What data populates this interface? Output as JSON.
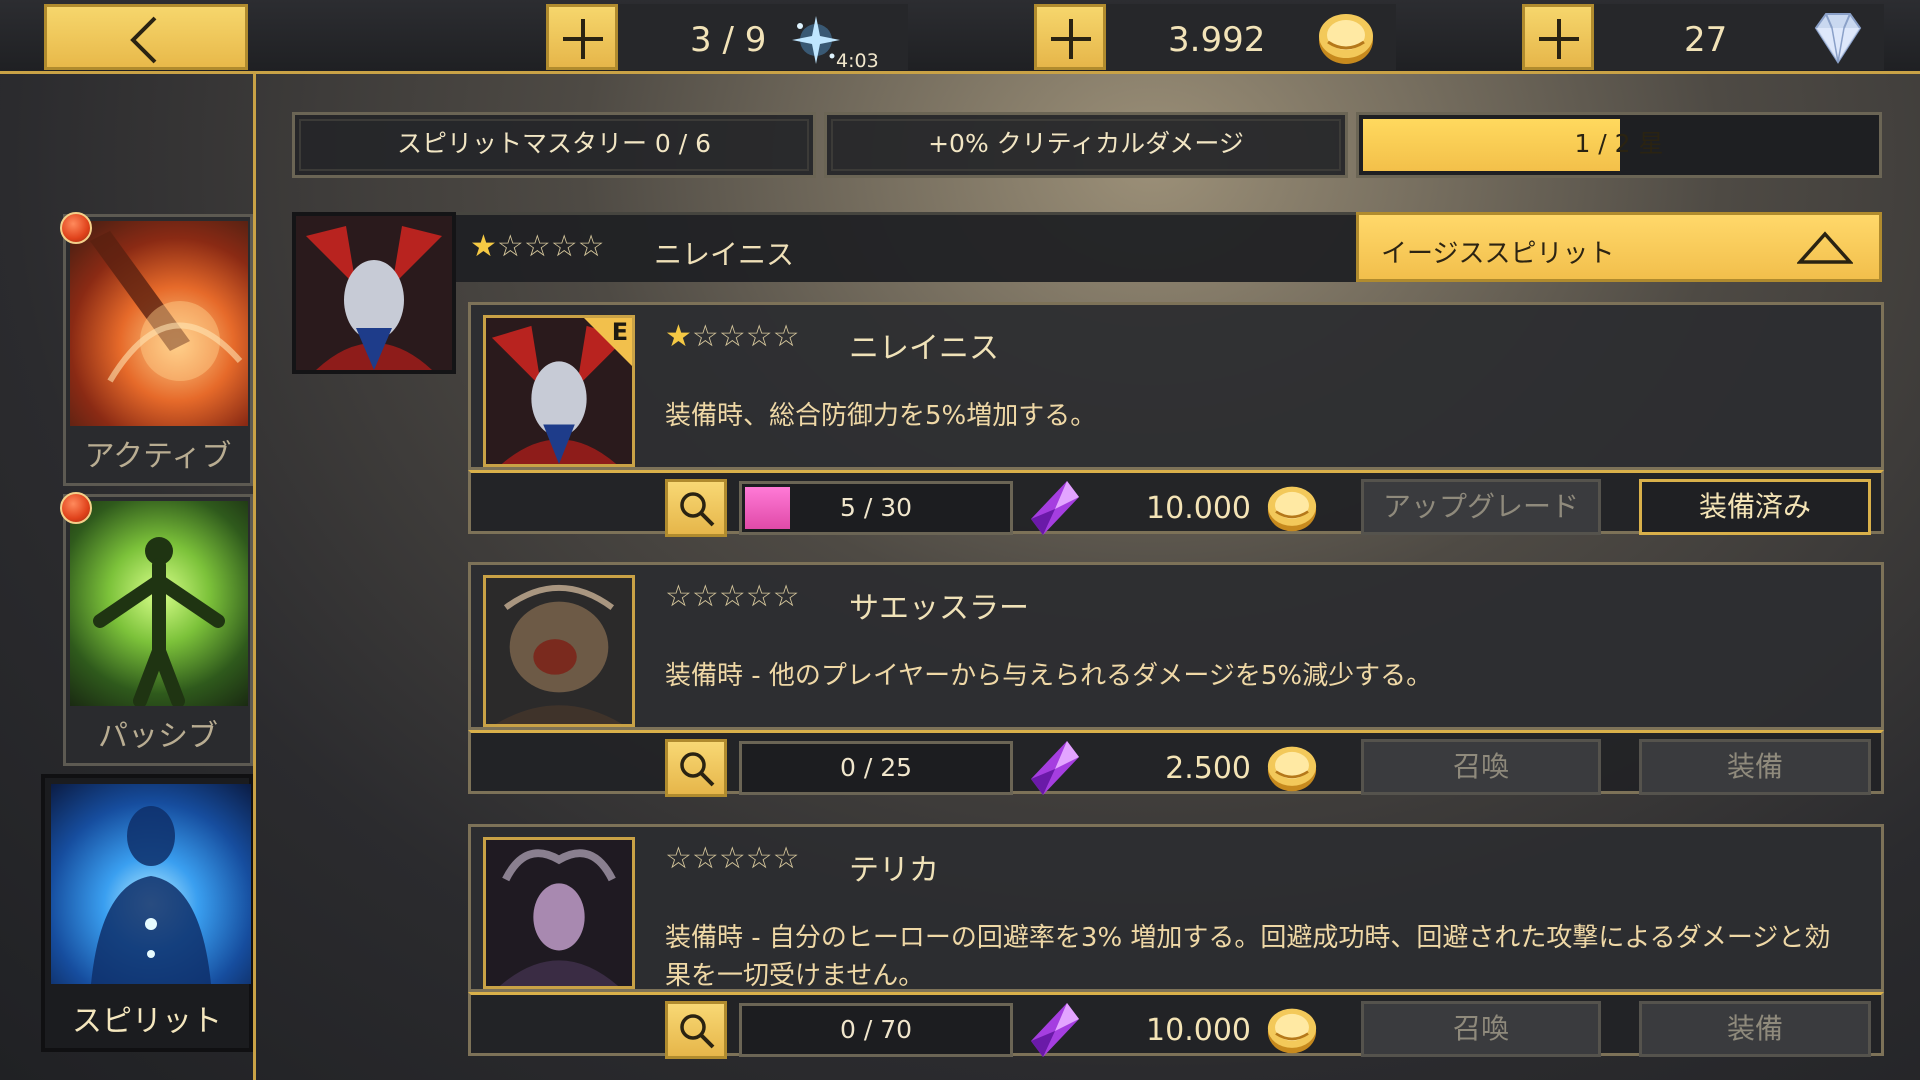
{
  "topbar": {
    "energy": "3 / 9",
    "energy_timer": "4:03",
    "gold": "3.992",
    "gems": "27"
  },
  "sidebar": {
    "tabs": [
      {
        "label": "アクティブ",
        "active": false,
        "badge": true
      },
      {
        "label": "パッシブ",
        "active": false,
        "badge": true
      },
      {
        "label": "スピリット",
        "active": true,
        "badge": false
      }
    ]
  },
  "header": {
    "mastery": "スピリットマスタリー 0 / 6",
    "crit": "+0% クリティカルダメージ",
    "star_progress_text": "1 / 2 星",
    "star_progress_fraction": 0.5
  },
  "selected": {
    "stars": 1,
    "name": "ニレイニス",
    "dropdown_label": "イージススピリット"
  },
  "cards": [
    {
      "name": "ニレイニス",
      "stars": 1,
      "grade": "E",
      "description": "装備時、総合防御力を5%増加する。",
      "progress_text": "5 / 30",
      "progress_fraction": 0.1667,
      "cost": "10.000",
      "primary_action": "アップグレード",
      "secondary_action": "装備済み",
      "equipped": true
    },
    {
      "name": "サエッスラー",
      "stars": 0,
      "grade": "",
      "description": "装備時 - 他のプレイヤーから与えられるダメージを5%減少する。",
      "progress_text": "0 / 25",
      "progress_fraction": 0,
      "cost": "2.500",
      "primary_action": "召喚",
      "secondary_action": "装備",
      "equipped": false
    },
    {
      "name": "テリカ",
      "stars": 0,
      "grade": "",
      "description": "装備時 - 自分のヒーローの回避率を3% 増加する。回避成功時、回避された攻撃によるダメージと効果を一切受けません。",
      "progress_text": "0 / 70",
      "progress_fraction": 0,
      "cost": "10.000",
      "primary_action": "召喚",
      "secondary_action": "装備",
      "equipped": false
    }
  ],
  "colors": {
    "accent_gold": "#f2c04c",
    "frame_gold": "#d9b04a",
    "progress_pink": "#e04aa8",
    "panel_dark": "#2c2d30"
  },
  "icons": [
    "back-arrow-icon",
    "plus-icon",
    "energy-sparkle-icon",
    "gold-coin-icon",
    "diamond-gem-icon",
    "search-icon",
    "purple-crystal-icon",
    "chevron-up-icon",
    "star-icon"
  ]
}
